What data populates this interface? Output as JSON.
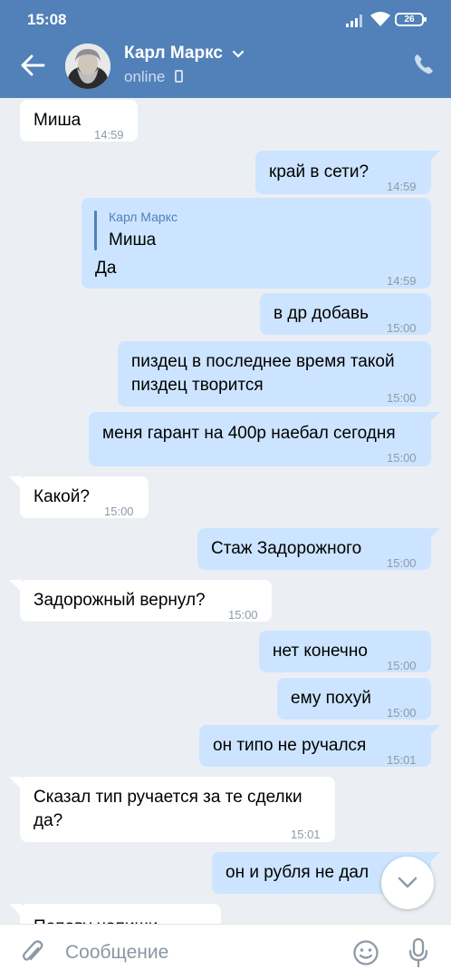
{
  "status_bar": {
    "time": "15:08",
    "battery": "26"
  },
  "header": {
    "contact_name": "Карл Маркс",
    "presence": "online"
  },
  "messages": [
    {
      "dir": "in",
      "text": "Миша",
      "time": "14:59"
    },
    {
      "dir": "out",
      "text": "край в сети?",
      "time": "14:59"
    },
    {
      "dir": "out",
      "reply_author": "Карл Маркс",
      "reply_text": "Миша",
      "text": "Да",
      "time": "14:59"
    },
    {
      "dir": "out",
      "text": "в др добавь",
      "time": "15:00"
    },
    {
      "dir": "out",
      "lines": [
        "пиздец в последнее время такой",
        "пиздец творится"
      ],
      "time": "15:00"
    },
    {
      "dir": "out",
      "text": "меня гарант на 400р наебал сегодня",
      "time": "15:00"
    },
    {
      "dir": "in",
      "text": "Какой?",
      "time": "15:00"
    },
    {
      "dir": "out",
      "text": "Стаж Задорожного",
      "time": "15:00"
    },
    {
      "dir": "in",
      "text": "Задорожный вернул?",
      "time": "15:00"
    },
    {
      "dir": "out",
      "text": "нет конечно",
      "time": "15:00"
    },
    {
      "dir": "out",
      "text": "ему похуй",
      "time": "15:00"
    },
    {
      "dir": "out",
      "text": "он типо не ручался",
      "time": "15:01"
    },
    {
      "dir": "in",
      "lines": [
        "Сказал тип ручается за те сделки",
        "да?"
      ],
      "time": "15:01"
    },
    {
      "dir": "out",
      "text": "он и рубля не дал",
      "time": ""
    },
    {
      "dir": "in",
      "text": "Попову напиши",
      "time": ""
    }
  ],
  "composer": {
    "placeholder": "Сообщение"
  },
  "colors": {
    "header": "#5181b8",
    "outgoing": "#cce4ff",
    "incoming": "#ffffff",
    "background": "#ebeff3"
  },
  "icons": [
    "back-arrow-icon",
    "chevron-down-icon",
    "phone-icon",
    "mobile-icon",
    "paperclip-icon",
    "emoji-icon",
    "microphone-icon",
    "scroll-down-icon"
  ]
}
